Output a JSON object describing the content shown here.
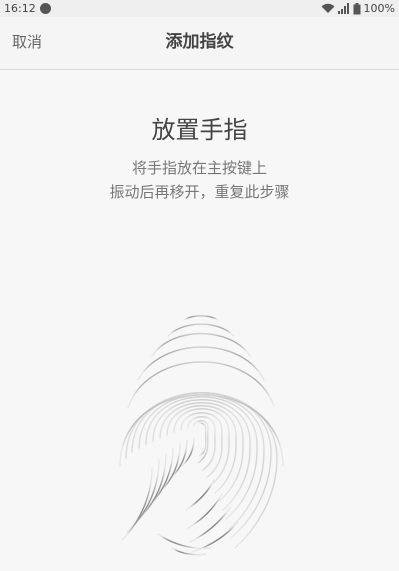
{
  "status_bar": {
    "time": "16:12",
    "battery": "100%",
    "icons": [
      "wifi-icon",
      "signal-icon",
      "battery-icon"
    ]
  },
  "nav": {
    "cancel_label": "取消",
    "title": "添加指纹"
  },
  "content": {
    "heading": "放置手指",
    "instruction_line1": "将手指放在主按键上",
    "instruction_line2": "振动后再移开，重复此步骤",
    "illustration_icon": "fingerprint-icon"
  }
}
